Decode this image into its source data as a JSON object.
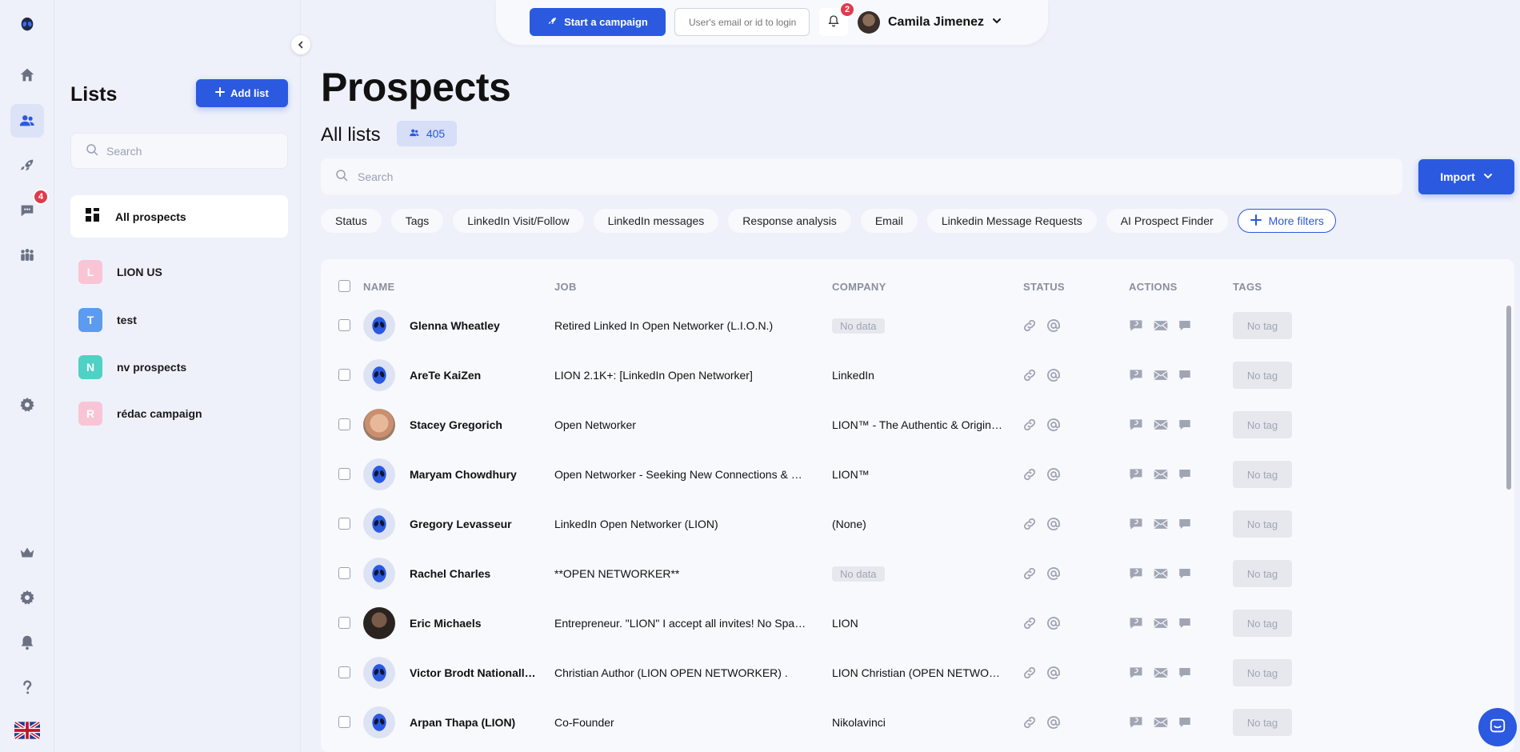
{
  "nav": {
    "messages_badge": "4",
    "items": [
      "logo-icon",
      "home-icon",
      "users-icon",
      "rocket-icon",
      "chat-icon",
      "team-icon",
      "settings-icon",
      "crown-icon",
      "gear-icon",
      "bell-icon",
      "help-icon",
      "flag-uk-icon"
    ]
  },
  "topbar": {
    "start_campaign_label": "Start a campaign",
    "login_placeholder": "User's email or id to login",
    "notifications_count": "2",
    "user_name": "Camila Jimenez"
  },
  "lists_panel": {
    "title": "Lists",
    "add_list_label": "Add list",
    "search_placeholder": "Search",
    "all_prospects_label": "All prospects",
    "lists": [
      {
        "initial": "L",
        "name": "LION US",
        "color": "#f9c5d5"
      },
      {
        "initial": "T",
        "name": "test",
        "color": "#5b9bf0"
      },
      {
        "initial": "N",
        "name": "nv prospects",
        "color": "#4fd1c5"
      },
      {
        "initial": "R",
        "name": "rédac campaign",
        "color": "#f9c5d5"
      }
    ]
  },
  "main": {
    "title": "Prospects",
    "subtitle": "All lists",
    "count": "405",
    "search_placeholder": "Search",
    "import_label": "Import",
    "filters": [
      "Status",
      "Tags",
      "LinkedIn Visit/Follow",
      "LinkedIn messages",
      "Response analysis",
      "Email",
      "Linkedin Message Requests",
      "AI Prospect Finder"
    ],
    "more_filters_label": "More filters"
  },
  "table": {
    "columns": {
      "name": "NAME",
      "job": "JOB",
      "company": "COMPANY",
      "status": "STATUS",
      "actions": "ACTIONS",
      "tags": "TAGS"
    },
    "rows": [
      {
        "name": "Glenna Wheatley",
        "job": "Retired Linked In Open Networker (L.I.O.N.)",
        "company": "No data",
        "company_missing": true,
        "avatar": "alien",
        "tag": "No tag"
      },
      {
        "name": "AreTe KaiZen",
        "job": "LION 2.1K+: [LinkedIn Open Networker]",
        "company": "LinkedIn",
        "company_missing": false,
        "avatar": "alien",
        "tag": "No tag"
      },
      {
        "name": "Stacey Gregorich",
        "job": "Open Networker",
        "company": "LION™ - The Authentic & Origin…",
        "company_missing": false,
        "avatar": "photo-light",
        "tag": "No tag"
      },
      {
        "name": "Maryam Chowdhury",
        "job": "Open Networker - Seeking New Connections & …",
        "company": "LION™",
        "company_missing": false,
        "avatar": "alien",
        "tag": "No tag"
      },
      {
        "name": "Gregory Levasseur",
        "job": "LinkedIn Open Networker (LION)",
        "company": "(None)",
        "company_missing": false,
        "avatar": "alien",
        "tag": "No tag"
      },
      {
        "name": "Rachel Charles",
        "job": "**OPEN NETWORKER**",
        "company": "No data",
        "company_missing": true,
        "avatar": "alien",
        "tag": "No tag"
      },
      {
        "name": "Eric Michaels",
        "job": "Entrepreneur. \"LION\" I accept all invites! No Spa…",
        "company": "LION",
        "company_missing": false,
        "avatar": "photo-dark",
        "tag": "No tag"
      },
      {
        "name": "Victor Brodt Nationall…",
        "job": "Christian Author (LION OPEN NETWORKER) .",
        "company": "LION Christian (OPEN NETWO…",
        "company_missing": false,
        "avatar": "alien",
        "tag": "No tag"
      },
      {
        "name": "Arpan Thapa (LION)",
        "job": "Co-Founder",
        "company": "Nikolavinci",
        "company_missing": false,
        "avatar": "alien",
        "tag": "No tag"
      }
    ]
  }
}
